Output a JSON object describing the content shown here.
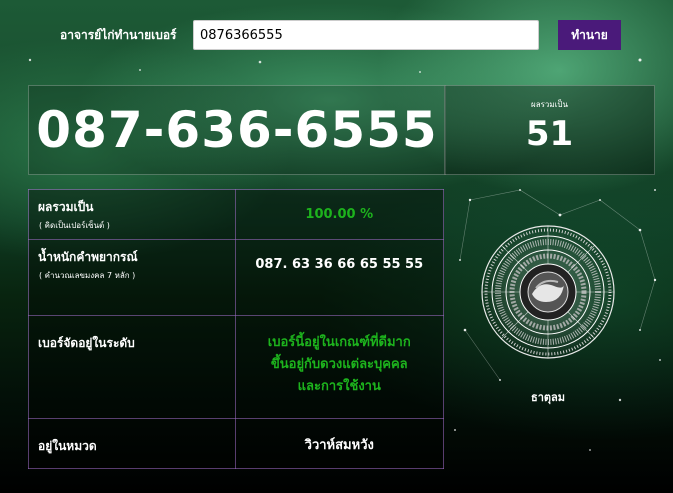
{
  "header": {
    "label": "อาจารย์ไก่ทำนายเบอร์",
    "input_value": "0876366555",
    "button_label": "ทำนาย"
  },
  "result": {
    "phone_display": "087-636-6555",
    "sum_label": "ผลรวมเป็น",
    "sum_value": "51"
  },
  "rows": [
    {
      "label": "ผลรวมเป็น",
      "sub": "( คิดเป็นเปอร์เซ็นต์ )",
      "value": "100.00 %"
    },
    {
      "label": "น้ำหนักคำพยากรณ์",
      "sub": "( คำนวณเลขมงคล 7 หลัก )",
      "value": "087. 63 36 66 65 55 55"
    },
    {
      "label": "เบอร์จัดอยู่ในระดับ",
      "value_lines": [
        "เบอร์นี้อยู่ในเกณฑ์ที่ดีมาก",
        "ขึ้นอยู่กับดวงแต่ละบุคคล",
        "และการใช้งาน"
      ]
    },
    {
      "label": "อยู่ในหมวด",
      "value": "วิวาห์สมหวัง"
    }
  ],
  "element": {
    "icon": "zodiac-wheel-icon",
    "caption": "ธาตุลม"
  },
  "colors": {
    "button": "#4a1a7a",
    "good_value": "#1db31d",
    "table_border": "#a06ec8"
  }
}
